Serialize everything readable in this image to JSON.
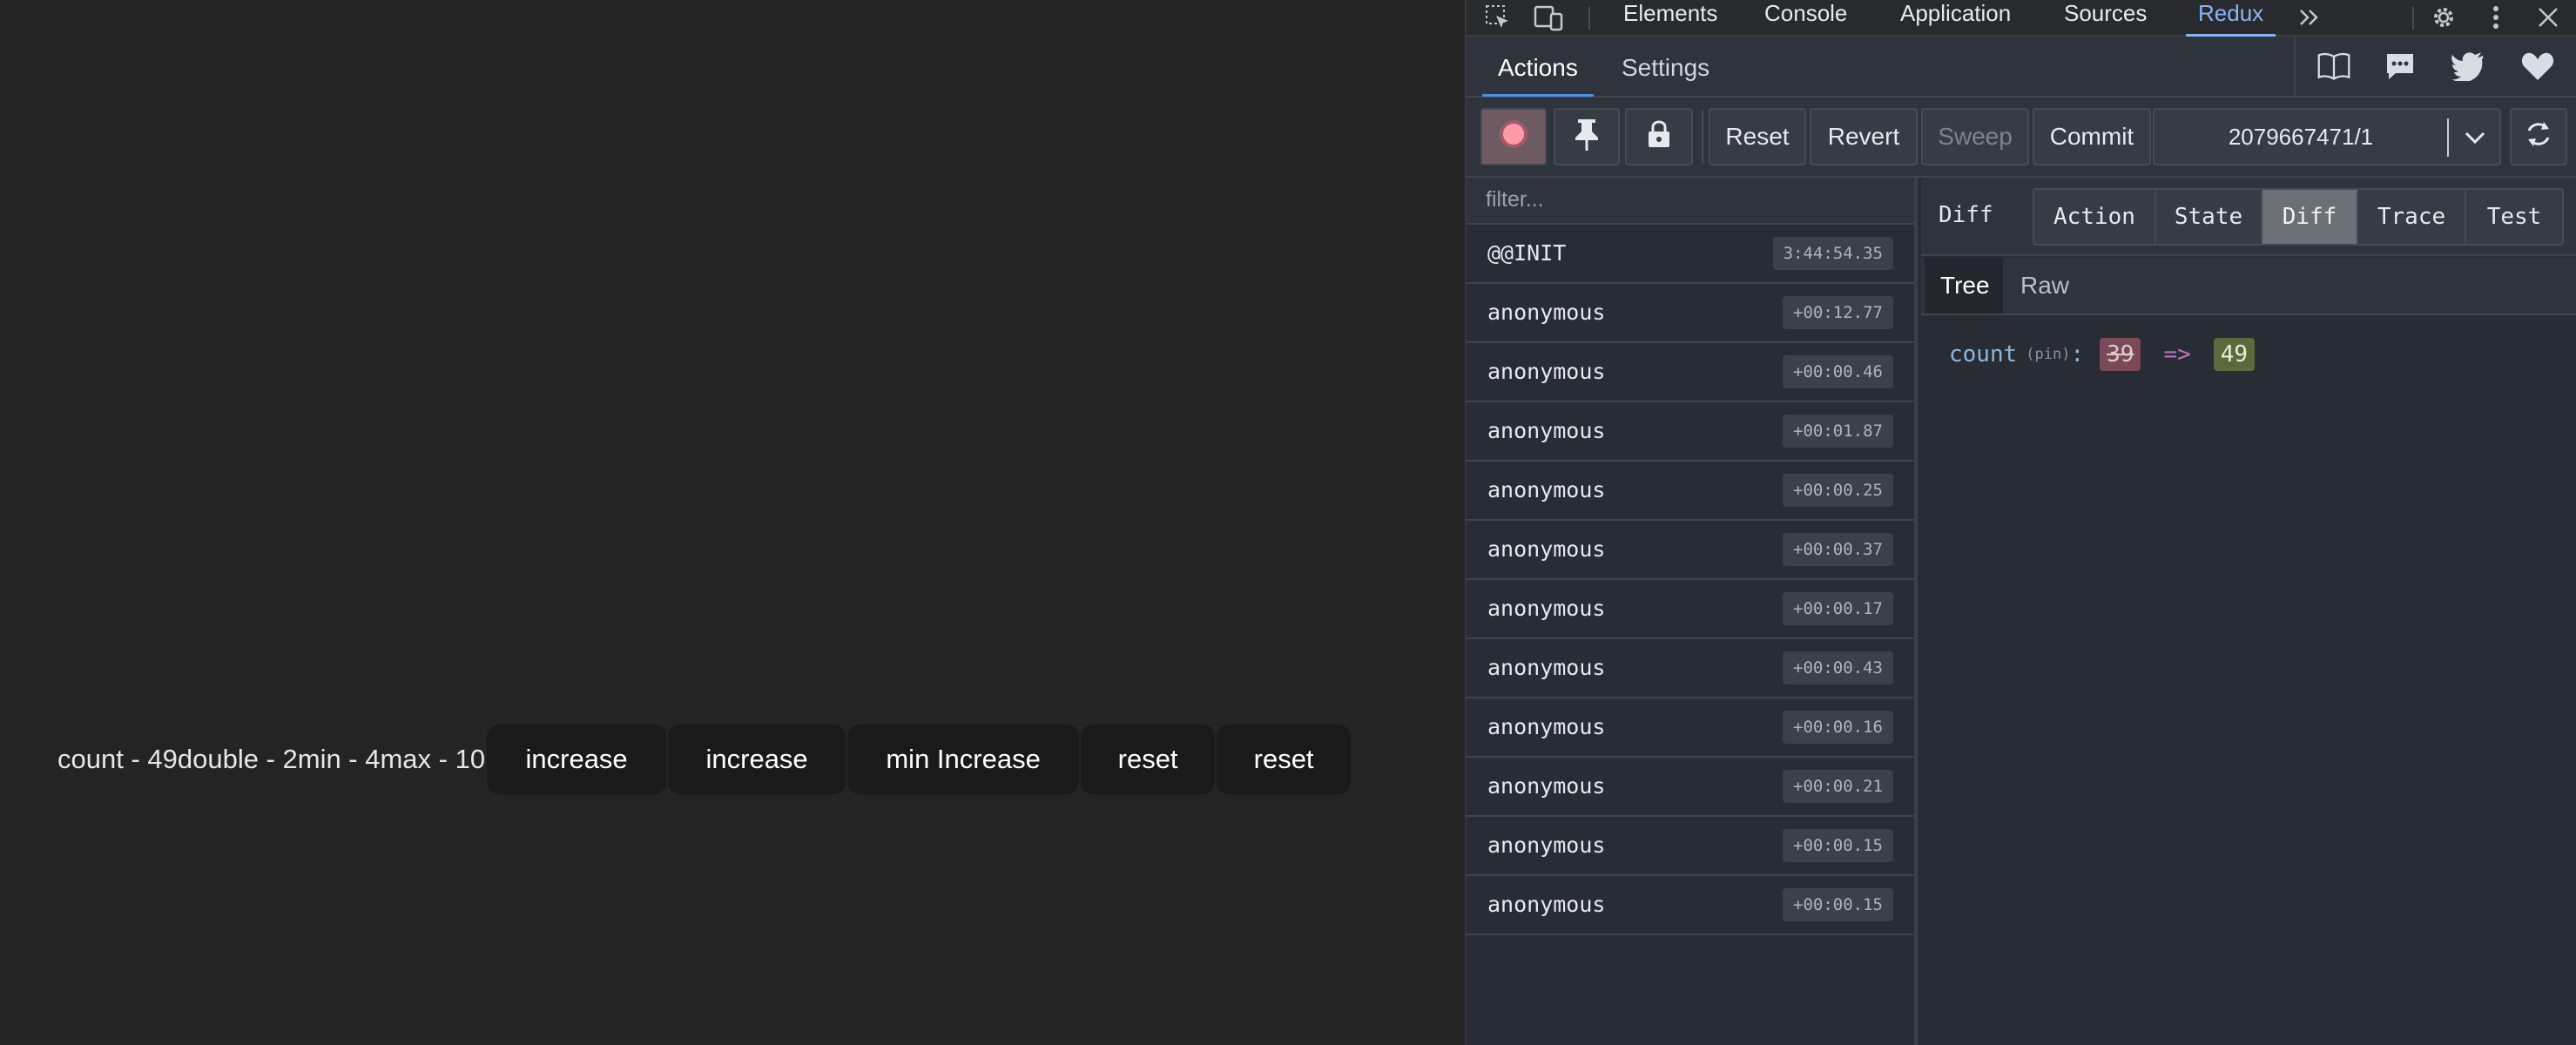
{
  "app": {
    "count_text": "count - 49double - 2min - 4max - 10",
    "buttons": [
      "increase",
      "increase",
      "min Increase",
      "reset",
      "reset"
    ]
  },
  "devtools": {
    "tabs": [
      "Elements",
      "Console",
      "Application",
      "Sources",
      "Redux"
    ],
    "active_tab": "Redux",
    "icons": [
      "inspect-element-icon",
      "device-toolbar-icon",
      "more-tabs-icon",
      "settings-icon",
      "more-options-icon",
      "close-icon"
    ]
  },
  "redux": {
    "tabs": [
      "Actions",
      "Settings"
    ],
    "active_tab": "Actions",
    "header_icons": [
      "book-icon",
      "chat-icon",
      "twitter-icon",
      "heart-icon"
    ],
    "toolbar": {
      "icons": [
        "record-icon",
        "pin-icon",
        "lock-icon"
      ],
      "buttons": [
        "Reset",
        "Revert",
        "Sweep",
        "Commit"
      ],
      "disabled": [
        "Sweep"
      ],
      "instance": "2079667471/1"
    },
    "filter_placeholder": "filter...",
    "actions": [
      {
        "name": "@@INIT",
        "time": "3:44:54.35"
      },
      {
        "name": "anonymous",
        "time": "+00:12.77"
      },
      {
        "name": "anonymous",
        "time": "+00:00.46"
      },
      {
        "name": "anonymous",
        "time": "+00:01.87"
      },
      {
        "name": "anonymous",
        "time": "+00:00.25"
      },
      {
        "name": "anonymous",
        "time": "+00:00.37"
      },
      {
        "name": "anonymous",
        "time": "+00:00.17"
      },
      {
        "name": "anonymous",
        "time": "+00:00.43"
      },
      {
        "name": "anonymous",
        "time": "+00:00.16"
      },
      {
        "name": "anonymous",
        "time": "+00:00.21"
      },
      {
        "name": "anonymous",
        "time": "+00:00.15"
      },
      {
        "name": "anonymous",
        "time": "+00:00.15"
      }
    ],
    "detail": {
      "title": "Diff",
      "segments": [
        "Action",
        "State",
        "Diff",
        "Trace",
        "Test"
      ],
      "active_segment": "Diff",
      "view_tabs": [
        "Tree",
        "Raw"
      ],
      "active_view": "Tree",
      "diff": {
        "key": "count",
        "pin": "(pin)",
        "colon": ":",
        "old": "39",
        "arrow": "=>",
        "new": "49"
      }
    }
  },
  "colors": {
    "page_bg": "#242424",
    "button_bg": "#1a1a1a",
    "devtools_active_tab": "#8ab4f8",
    "redux_bg": "#282c34",
    "diff_old": "#7a4a58",
    "diff_new": "#5a6a3c"
  }
}
